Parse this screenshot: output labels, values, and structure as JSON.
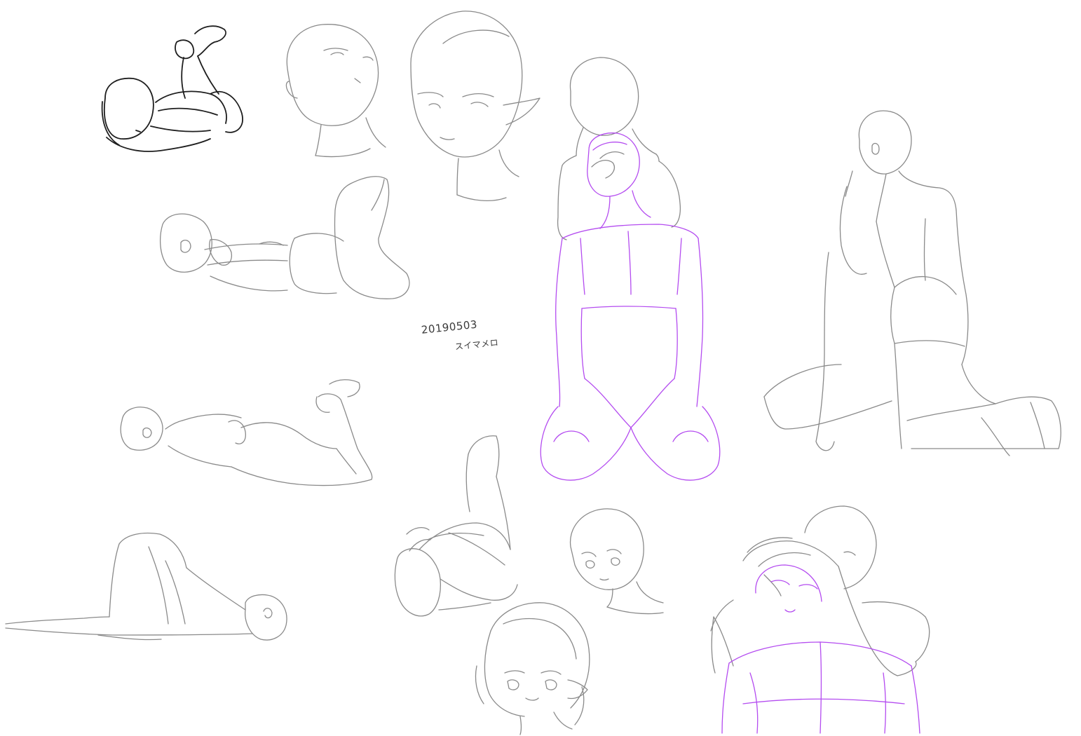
{
  "signature": {
    "date": "20190503",
    "name": "スイマメロ"
  },
  "colors": {
    "background": "#ffffff",
    "pencil": "#8a8a8a",
    "ink": "#1e1e1e",
    "accent_lines": "#b44cf0"
  }
}
